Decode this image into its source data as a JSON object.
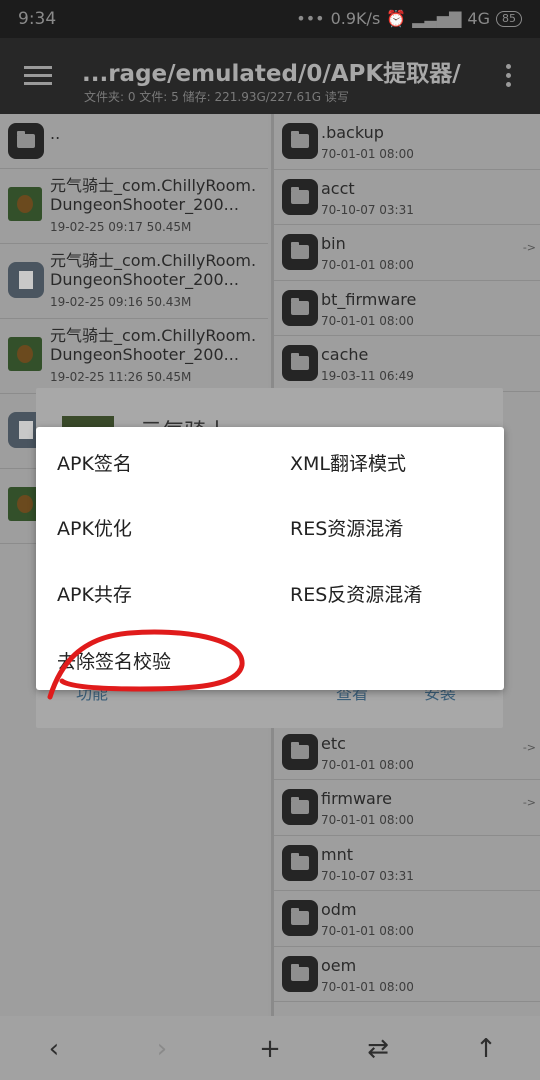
{
  "status_bar": {
    "time": "9:34",
    "dots": "•••",
    "speed": "0.9K/s",
    "network": "4G",
    "battery": "85"
  },
  "app_bar": {
    "path": "...rage/emulated/0/APK提取器/",
    "info": "文件夹: 0  文件: 5  储存: 221.93G/227.61G  读写"
  },
  "left_pane": {
    "parent_label": "..",
    "items": [
      {
        "name": "元气骑士_com.ChillyRoom.DungeonShooter_200...",
        "meta": "19-02-25 09:17  50.45M",
        "icon": "apk-icon"
      },
      {
        "name": "元气骑士_com.ChillyRoom.DungeonShooter_200...",
        "meta": "19-02-25 09:16  50.43M",
        "icon": "document-icon"
      },
      {
        "name": "元气骑士_com.ChillyRoom.DungeonShooter_200...",
        "meta": "19-02-25 11:26  50.45M",
        "icon": "apk-icon"
      }
    ]
  },
  "right_pane": {
    "items": [
      {
        "name": ".backup",
        "meta": "70-01-01 08:00",
        "arrow": ""
      },
      {
        "name": "acct",
        "meta": "70-10-07 03:31",
        "arrow": ""
      },
      {
        "name": "bin",
        "meta": "70-01-01 08:00",
        "arrow": "->"
      },
      {
        "name": "bt_firmware",
        "meta": "70-01-01 08:00",
        "arrow": ""
      },
      {
        "name": "cache",
        "meta": "19-03-11 06:49",
        "arrow": ""
      },
      {
        "name": "etc",
        "meta": "70-01-01 08:00",
        "arrow": "->"
      },
      {
        "name": "firmware",
        "meta": "70-01-01 08:00",
        "arrow": "->"
      },
      {
        "name": "mnt",
        "meta": "70-10-07 03:31",
        "arrow": ""
      },
      {
        "name": "odm",
        "meta": "70-01-01 08:00",
        "arrow": ""
      },
      {
        "name": "oem",
        "meta": "70-01-01 08:00",
        "arrow": ""
      }
    ]
  },
  "back_dialog": {
    "title": "元气骑士",
    "btn_function": "功能",
    "btn_view": "查看",
    "btn_install": "安装"
  },
  "popup_menu": {
    "items": [
      "APK签名",
      "XML翻译模式",
      "APK优化",
      "RES资源混淆",
      "APK共存",
      "RES反资源混淆",
      "去除签名校验"
    ]
  },
  "annotation": {
    "color": "#e01b1b"
  },
  "bottom_bar": {
    "back": "‹",
    "forward": "›",
    "add": "+",
    "swap": "⇄",
    "up": "↑"
  }
}
